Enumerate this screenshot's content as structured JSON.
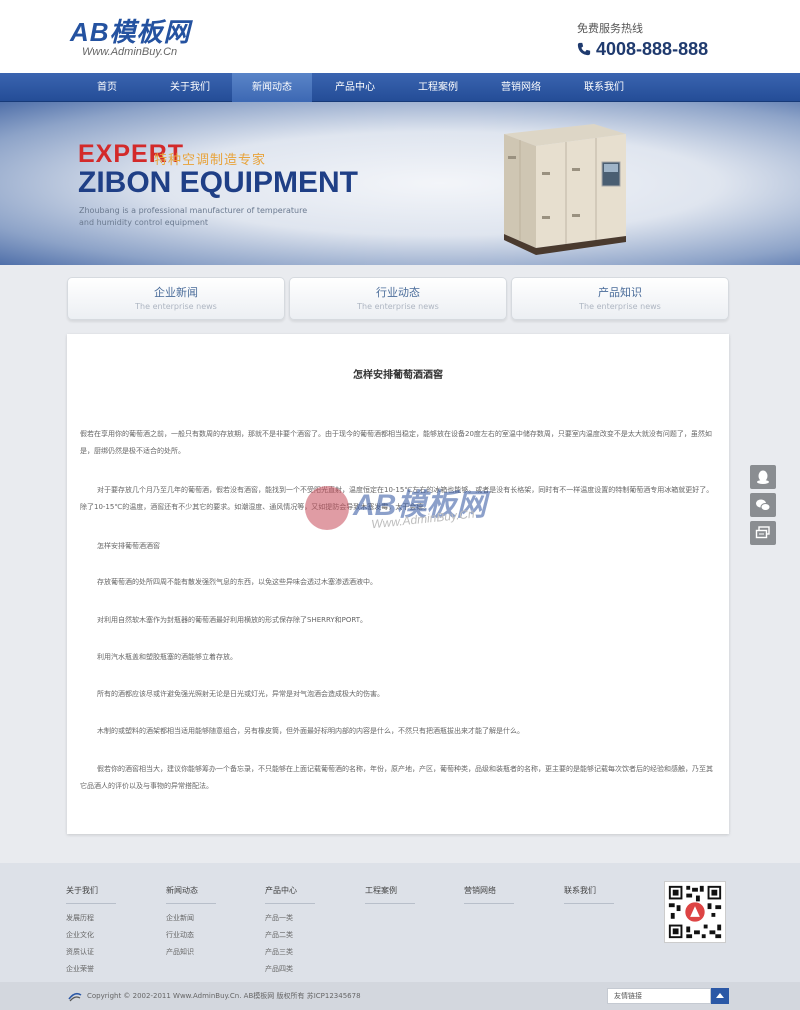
{
  "header": {
    "logo_text": "AB模板网",
    "logo_sub": "Www.AdminBuy.Cn",
    "hotline_label": "免费服务热线",
    "hotline_number": "4008-888-888"
  },
  "nav": [
    {
      "label": "首页",
      "active": false
    },
    {
      "label": "关于我们",
      "active": false
    },
    {
      "label": "新闻动态",
      "active": true
    },
    {
      "label": "产品中心",
      "active": false
    },
    {
      "label": "工程案例",
      "active": false
    },
    {
      "label": "营销网络",
      "active": false
    },
    {
      "label": "联系我们",
      "active": false
    }
  ],
  "banner": {
    "expert": "EXPERT",
    "expert_cn": "特种空调制造专家",
    "zibon": "ZIBON EQUIPMENT",
    "description": "Zhoubang is a professional manufacturer of temperature and humidity control equipment"
  },
  "tabs": [
    {
      "title": "企业新闻",
      "sub": "The enterprise news"
    },
    {
      "title": "行业动态",
      "sub": "The enterprise news"
    },
    {
      "title": "产品知识",
      "sub": "The enterprise news"
    }
  ],
  "article": {
    "title": "怎样安排葡萄酒酒窖",
    "paragraphs": [
      "假若在享用你的葡萄酒之前，一般只有数周的存放期，那就不是非要个酒窖了。由于现今的葡萄酒都相当稳定，能够放在设备20度左右的室温中储存数周，只要室内温度改变不是太大就没有问题了，虽然如是，厨绑仍然是极不适合的处所。",
      "对于要存放几个月乃至几年的葡萄酒，假若没有酒窖，能找到一个不受阳光直射，温度恒定在10-15℃左右的冰箱也能够。或者是没有长格架，同时有不一样温度设置的特制葡萄酒专用冰箱就更好了。除了10-15℃的温度，酒窖还有不少其它的要求。如潮湿度、通风情况等，又如提防会导致木塞发霉，太干会瘪。",
      "怎样安排葡萄酒酒窖",
      "存放葡萄酒的处所四周不能有散发强烈气息的东西，以免这些异味会透过木塞渗透酒液中。",
      "对利用自然软木塞作为封瓶器的葡萄酒最好利用横放的形式保存除了SHERRY和PORT。",
      "利用汽水瓶盖和塑胶瓶塞的酒能够立着存放。",
      "所有的酒都应该尽或许避免强光照射无论是日光或灯光，异常是对气泡酒会造成极大的伤害。",
      "木制的或塑料的酒架都相当适用能够随意组合，另有橡皮筒，但外面最好标明内部的内容是什么，不然只有把酒瓶拔出来才能了解是什么。",
      "假若你的酒窖相当大，建议你能够筹办一个备忘录，不只能够在上面记载葡萄酒的名称，年份，原产地，产区，葡萄种类，品级和装瓶者的名称，更主要的是能够记载每次饮者后的经验和感触，乃至其它品酒人的评价以及与事物的异常搭配法。"
    ]
  },
  "watermark": {
    "main": "AB模板网",
    "sub": "Www.AdminBuy.Cn"
  },
  "footer": {
    "columns": [
      {
        "head": "关于我们",
        "links": [
          "发展历程",
          "企业文化",
          "资质认证",
          "企业荣誉"
        ]
      },
      {
        "head": "新闻动态",
        "links": [
          "企业新闻",
          "行业动态",
          "产品知识"
        ]
      },
      {
        "head": "产品中心",
        "links": [
          "产品一类",
          "产品二类",
          "产品三类",
          "产品四类"
        ]
      },
      {
        "head": "工程案例",
        "links": []
      },
      {
        "head": "营销网络",
        "links": []
      },
      {
        "head": "联系我们",
        "links": []
      }
    ],
    "copyright": "Copyright © 2002-2011 Www.AdminBuy.Cn. AB模板网 版权所有 苏ICP12345678",
    "friend_links_label": "友情链接"
  }
}
